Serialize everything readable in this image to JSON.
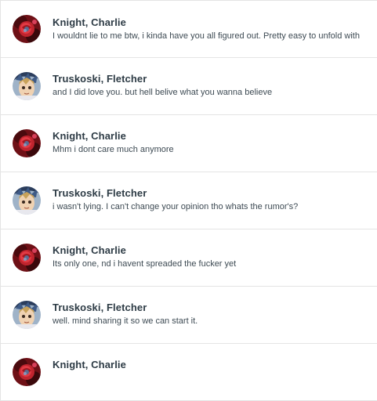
{
  "messages": [
    {
      "sender": "Knight, Charlie",
      "avatar": "red-rose-avatar-icon",
      "preview": "I wouldnt lie to me btw, i kinda have you all figured out. Pretty easy to unfold with"
    },
    {
      "sender": "Truskoski, Fletcher",
      "avatar": "anime-character-avatar-icon",
      "preview": "and I did love you. but hell belive what you wanna believe"
    },
    {
      "sender": "Knight, Charlie",
      "avatar": "red-rose-avatar-icon",
      "preview": "Mhm i dont care much anymore"
    },
    {
      "sender": "Truskoski, Fletcher",
      "avatar": "anime-character-avatar-icon",
      "preview": "i wasn't lying. I can't change your opinion tho whats the rumor's?"
    },
    {
      "sender": "Knight, Charlie",
      "avatar": "red-rose-avatar-icon",
      "preview": "Its only one, nd i havent spreaded the fucker yet"
    },
    {
      "sender": "Truskoski, Fletcher",
      "avatar": "anime-character-avatar-icon",
      "preview": "well. mind sharing it so we can start it."
    },
    {
      "sender": "Knight, Charlie",
      "avatar": "red-rose-avatar-icon",
      "preview": ""
    }
  ]
}
